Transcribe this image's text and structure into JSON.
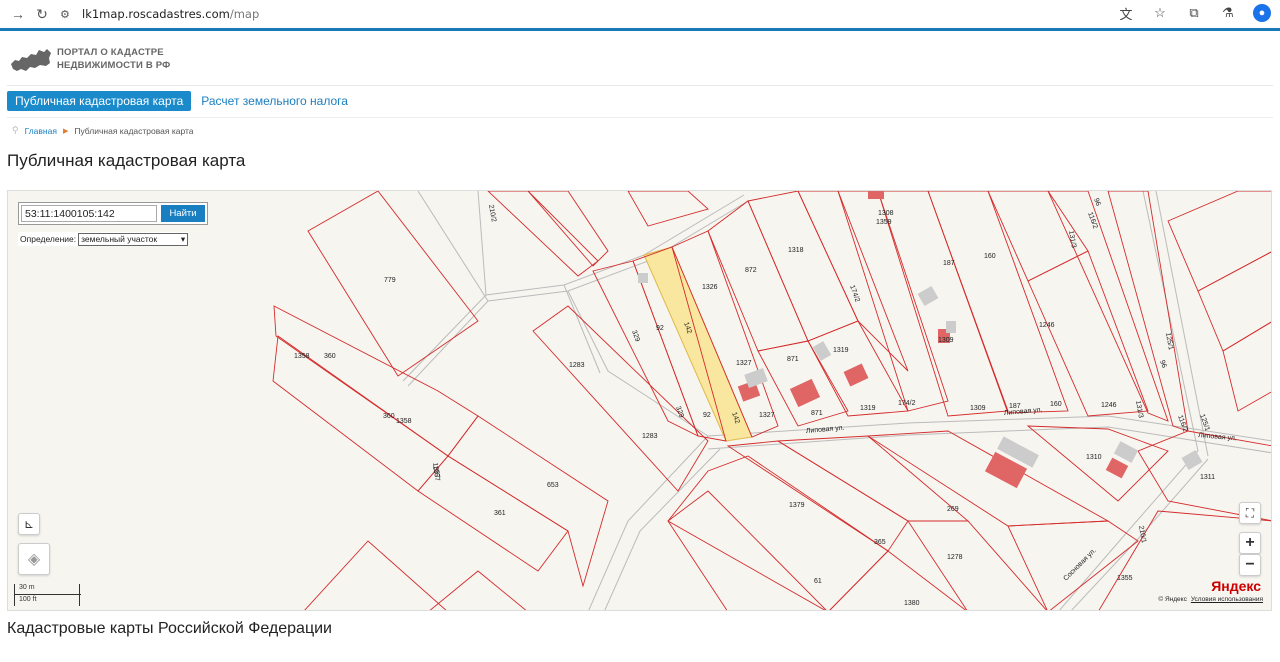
{
  "browser": {
    "url_host": "lk1map.roscadastres.com",
    "url_path": "/map"
  },
  "header": {
    "logo_line1": "ПОРТАЛ О КАДАСТРЕ",
    "logo_line2": "НЕДВИЖИМОСТИ В РФ"
  },
  "nav": {
    "active_label": "Публичная кадастровая карта",
    "link_label": "Расчет земельного налога"
  },
  "breadcrumb": {
    "home": "Главная",
    "current": "Публичная кадастровая карта"
  },
  "page_title": "Публичная кадастровая карта",
  "map": {
    "search_value": "53:11:1400105:142",
    "find_label": "Найти",
    "definition_label": "Определение:",
    "definition_value": "земельный участок",
    "scale_m": "30 m",
    "scale_ft": "100 ft",
    "yandex_logo": "Яндекс",
    "copyright": "© Яндекс",
    "terms": "Условия использования",
    "parcel_labels": [
      "779",
      "1358",
      "360",
      "360",
      "1358",
      "1357",
      "361",
      "1357",
      "653",
      "1283",
      "1283",
      "329",
      "92",
      "142",
      "329",
      "92",
      "142",
      "1326",
      "1327",
      "1327",
      "872",
      "871",
      "871",
      "1318",
      "174/2",
      "1319",
      "1319",
      "174/2",
      "1308",
      "1359",
      "187",
      "160",
      "1309",
      "1309",
      "187",
      "160",
      "1246",
      "1246",
      "131/3",
      "116/2",
      "96",
      "125/1",
      "131/3",
      "96",
      "116/2",
      "125/1",
      "210/2",
      "1379",
      "365",
      "269",
      "1278",
      "1310",
      "1311",
      "210/1",
      "1355",
      "1380",
      "61",
      "Липовая ул.",
      "Липовая ул.",
      "Липовая ул.",
      "Сосновая ул."
    ],
    "accent_color": "#1a7fc0",
    "parcel_line_color": "#d42b2b",
    "highlight_color": "#f9e79f"
  },
  "section_title": "Кадастровые карты Российской Федерации"
}
